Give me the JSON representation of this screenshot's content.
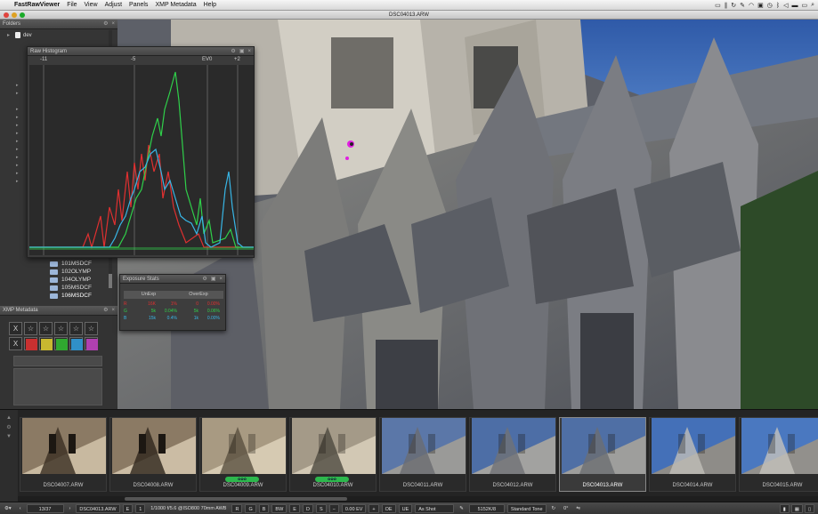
{
  "menubar": {
    "apple": "",
    "app_name": "FastRawViewer",
    "items": [
      "File",
      "View",
      "Adjust",
      "Panels",
      "XMP Metadata",
      "Help"
    ]
  },
  "window": {
    "title": "DSC04013.ARW"
  },
  "folders_panel": {
    "title": "Folders",
    "root": "dev",
    "subfolders": [
      "101MSDCF",
      "102OLYMP",
      "104OLYMP",
      "105MSDCF",
      "106MSDCF"
    ]
  },
  "raw_histogram": {
    "title": "Raw Histogram",
    "scale": [
      "-11",
      "-5",
      "EV0",
      "+2"
    ]
  },
  "exposure_stats": {
    "title": "Exposure Stats",
    "headers": [
      "UnExp",
      "OverExp"
    ],
    "rows": [
      {
        "color": "#e03030",
        "label": "R",
        "a": "16K",
        "b": "1%",
        "c": "0",
        "d": "0.00%"
      },
      {
        "color": "#2fd04a",
        "label": "G",
        "a": "5k",
        "b": "0.04%",
        "c": "5k",
        "d": "0.06%"
      },
      {
        "color": "#38b6e6",
        "label": "B",
        "a": "15k",
        "b": "0.4%",
        "c": "1k",
        "d": "0.00%"
      }
    ]
  },
  "xmp_panel": {
    "title": "XMP Metadata",
    "label_colors": [
      "#c83030",
      "#c8b830",
      "#30a830",
      "#3090c8",
      "#b040b0"
    ]
  },
  "filmstrip": [
    {
      "name": "DSC04007.ARW",
      "selected": false,
      "rating": ""
    },
    {
      "name": "DSC04008.ARW",
      "selected": false,
      "rating": ""
    },
    {
      "name": "DSC04009.ARW",
      "selected": false,
      "rating": "✿✿✿"
    },
    {
      "name": "DSC04010.ARW",
      "selected": false,
      "rating": "✿✿✿"
    },
    {
      "name": "DSC04011.ARW",
      "selected": false,
      "rating": ""
    },
    {
      "name": "DSC04012.ARW",
      "selected": false,
      "rating": ""
    },
    {
      "name": "DSC04013.ARW",
      "selected": true,
      "rating": ""
    },
    {
      "name": "DSC04014.ARW",
      "selected": false,
      "rating": ""
    },
    {
      "name": "DSC04015.ARW",
      "selected": false,
      "rating": ""
    }
  ],
  "bottombar": {
    "nav": "13/37",
    "filename": "DSC04013.ARW",
    "e": "E",
    "one": "1",
    "exif": "1/1000 f/5.6 @ISO800 70mm AWB",
    "ch_r": "R",
    "ch_g": "G",
    "ch_b": "B",
    "ch_bw": "BW",
    "e2": "E",
    "d": "D",
    "s": "S",
    "ev_value": "0.00 EV",
    "oe": "OE",
    "ue": "UE",
    "wb": "As Shot",
    "temp": "5152K/8",
    "tone": "Standard Tone",
    "angle": "0°"
  }
}
